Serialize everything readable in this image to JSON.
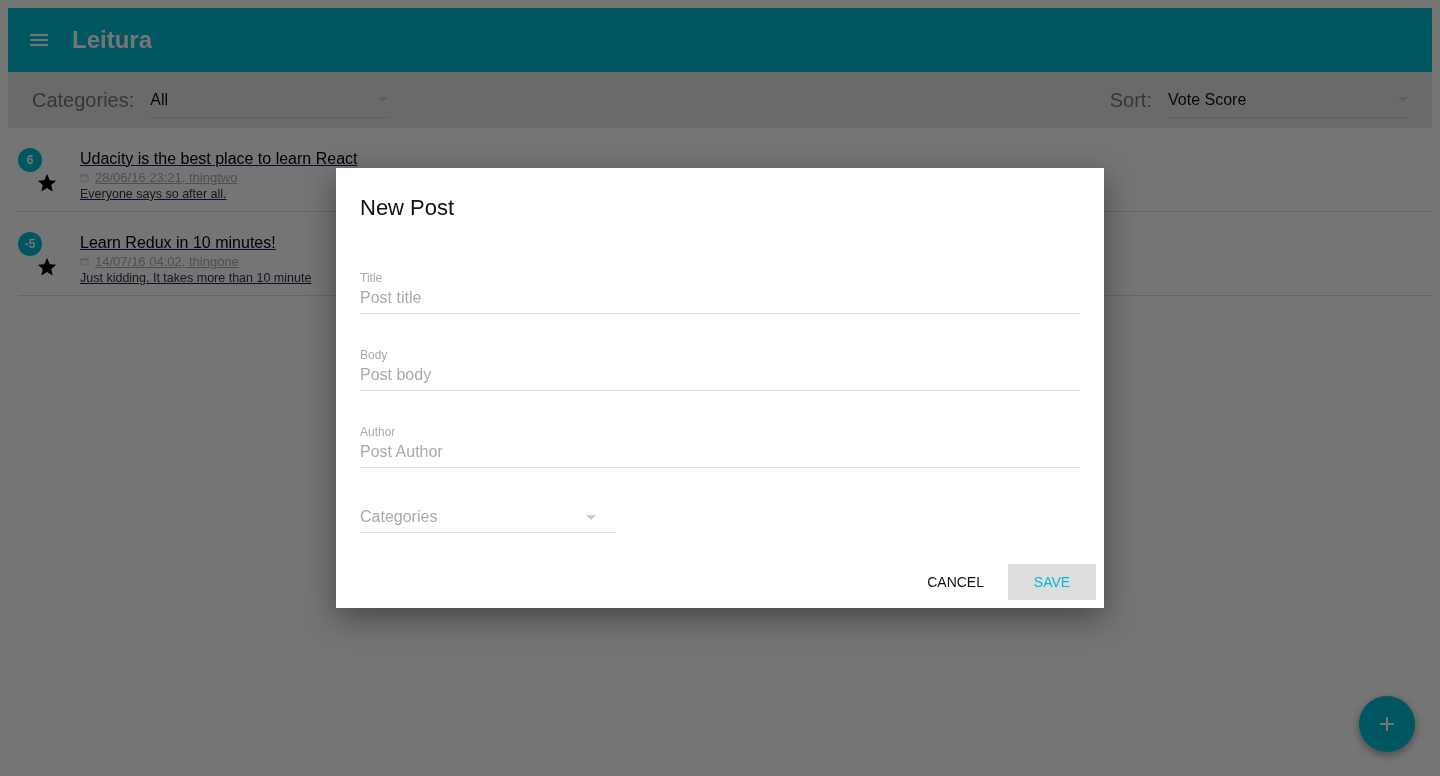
{
  "app_bar": {
    "title": "Leitura"
  },
  "filters": {
    "categories_label": "Categories:",
    "categories_value": "All",
    "sort_label": "Sort:",
    "sort_value": "Vote Score"
  },
  "posts": [
    {
      "score": "6",
      "title": "Udacity is the best place to learn React",
      "meta": "28/06/16 23:21, thingtwo",
      "body": "Everyone says so after all."
    },
    {
      "score": "-5",
      "title": "Learn Redux in 10 minutes!",
      "meta": "14/07/16 04:02, thingone",
      "body": "Just kidding. It takes more than 10 minute"
    }
  ],
  "dialog": {
    "title": "New Post",
    "fields": [
      {
        "label": "Title",
        "placeholder": "Post title"
      },
      {
        "label": "Body",
        "placeholder": "Post body"
      },
      {
        "label": "Author",
        "placeholder": "Post Author"
      }
    ],
    "select": {
      "placeholder": "Categories"
    },
    "buttons": [
      {
        "label": "CANCEL",
        "kind": "plain"
      },
      {
        "label": "SAVE",
        "kind": "primary"
      }
    ]
  }
}
